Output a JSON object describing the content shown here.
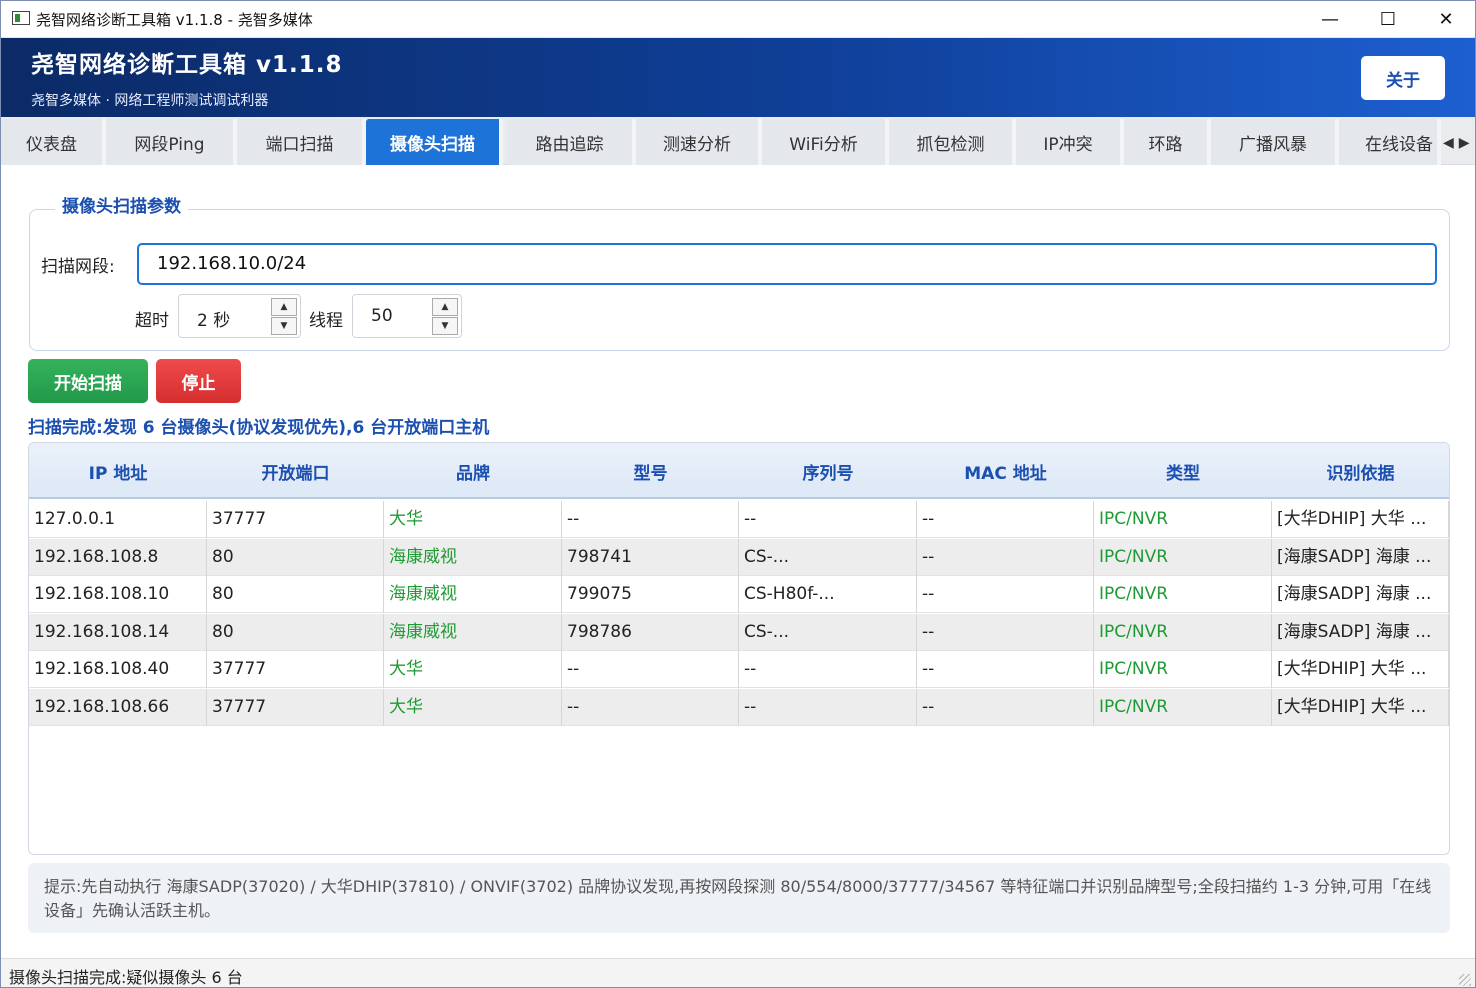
{
  "window": {
    "title": "尧智网络诊断工具箱 v1.1.8 - 尧智多媒体",
    "minimize": "—",
    "maximize": "☐",
    "close": "✕"
  },
  "header": {
    "title": "尧智网络诊断工具箱  v1.1.8",
    "subtitle": "尧智多媒体 · 网络工程师测试调试利器",
    "about": "关于"
  },
  "tabs": [
    "仪表盘",
    "网段Ping",
    "端口扫描",
    "摄像头扫描",
    "路由追踪",
    "测速分析",
    "WiFi分析",
    "抓包检测",
    "IP冲突",
    "环路",
    "广播风暴",
    "在线设备"
  ],
  "active_tab": "摄像头扫描",
  "params": {
    "group_title": "摄像头扫描参数",
    "range_label": "扫描网段:",
    "range_value": "192.168.10.0/24",
    "timeout_label": "超时",
    "timeout_value": "2 秒",
    "threads_label": "线程",
    "threads_value": "50"
  },
  "buttons": {
    "start": "开始扫描",
    "stop": "停止"
  },
  "scan_status": "扫描完成:发现 6 台摄像头(协议发现优先),6 台开放端口主机",
  "table": {
    "columns": [
      "IP 地址",
      "开放端口",
      "品牌",
      "型号",
      "序列号",
      "MAC 地址",
      "类型",
      "识别依据"
    ],
    "rows": [
      [
        "127.0.0.1",
        "37777",
        "大华",
        "--",
        "--",
        "--",
        "IPC/NVR",
        "[大华DHIP] 大华 ..."
      ],
      [
        "192.168.108.8",
        "80",
        "海康威视",
        "798741",
        "CS-...",
        "--",
        "IPC/NVR",
        "[海康SADP] 海康 ..."
      ],
      [
        "192.168.108.10",
        "80",
        "海康威视",
        "799075",
        "CS-H80f-...",
        "--",
        "IPC/NVR",
        "[海康SADP] 海康 ..."
      ],
      [
        "192.168.108.14",
        "80",
        "海康威视",
        "798786",
        "CS-...",
        "--",
        "IPC/NVR",
        "[海康SADP] 海康 ..."
      ],
      [
        "192.168.108.40",
        "37777",
        "大华",
        "--",
        "--",
        "--",
        "IPC/NVR",
        "[大华DHIP] 大华 ..."
      ],
      [
        "192.168.108.66",
        "37777",
        "大华",
        "--",
        "--",
        "--",
        "IPC/NVR",
        "[大华DHIP] 大华 ..."
      ]
    ]
  },
  "hint": "提示:先自动执行 海康SADP(37020) / 大华DHIP(37810) / ONVIF(3702) 品牌协议发现,再按网段探测 80/554/8000/37777/34567 等特征端口并识别品牌型号;全段扫描约 1-3 分钟,可用「在线设备」先确认活跃主机。",
  "statusbar": "摄像头扫描完成:疑似摄像头 6 台",
  "colors": {
    "accent": "#1e73d8",
    "header_dark": "#0b2a66",
    "brand_green": "#1f9a34",
    "start_green": "#22994a",
    "stop_red": "#d42e2e"
  }
}
